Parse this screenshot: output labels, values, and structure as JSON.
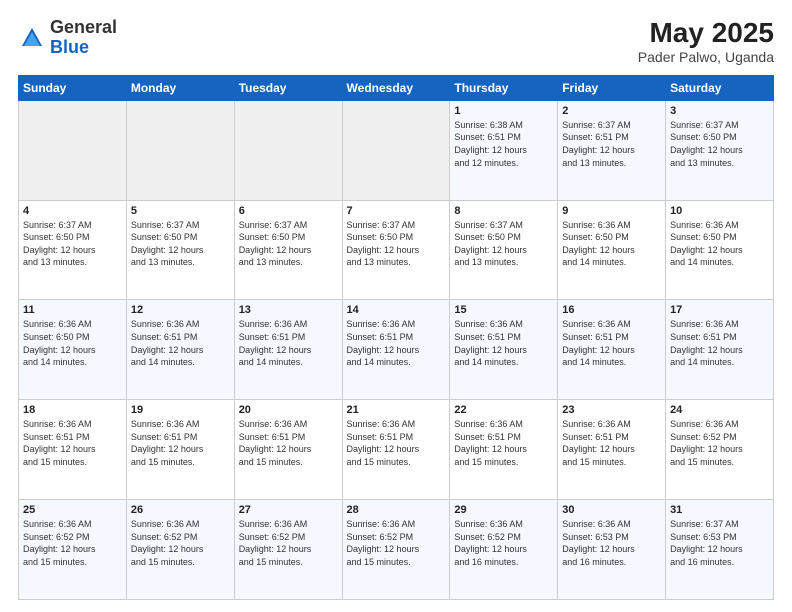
{
  "header": {
    "logo_general": "General",
    "logo_blue": "Blue",
    "month_title": "May 2025",
    "location": "Pader Palwo, Uganda"
  },
  "days_of_week": [
    "Sunday",
    "Monday",
    "Tuesday",
    "Wednesday",
    "Thursday",
    "Friday",
    "Saturday"
  ],
  "weeks": [
    [
      {
        "day": "",
        "info": ""
      },
      {
        "day": "",
        "info": ""
      },
      {
        "day": "",
        "info": ""
      },
      {
        "day": "",
        "info": ""
      },
      {
        "day": "1",
        "info": "Sunrise: 6:38 AM\nSunset: 6:51 PM\nDaylight: 12 hours\nand 12 minutes."
      },
      {
        "day": "2",
        "info": "Sunrise: 6:37 AM\nSunset: 6:51 PM\nDaylight: 12 hours\nand 13 minutes."
      },
      {
        "day": "3",
        "info": "Sunrise: 6:37 AM\nSunset: 6:50 PM\nDaylight: 12 hours\nand 13 minutes."
      }
    ],
    [
      {
        "day": "4",
        "info": "Sunrise: 6:37 AM\nSunset: 6:50 PM\nDaylight: 12 hours\nand 13 minutes."
      },
      {
        "day": "5",
        "info": "Sunrise: 6:37 AM\nSunset: 6:50 PM\nDaylight: 12 hours\nand 13 minutes."
      },
      {
        "day": "6",
        "info": "Sunrise: 6:37 AM\nSunset: 6:50 PM\nDaylight: 12 hours\nand 13 minutes."
      },
      {
        "day": "7",
        "info": "Sunrise: 6:37 AM\nSunset: 6:50 PM\nDaylight: 12 hours\nand 13 minutes."
      },
      {
        "day": "8",
        "info": "Sunrise: 6:37 AM\nSunset: 6:50 PM\nDaylight: 12 hours\nand 13 minutes."
      },
      {
        "day": "9",
        "info": "Sunrise: 6:36 AM\nSunset: 6:50 PM\nDaylight: 12 hours\nand 14 minutes."
      },
      {
        "day": "10",
        "info": "Sunrise: 6:36 AM\nSunset: 6:50 PM\nDaylight: 12 hours\nand 14 minutes."
      }
    ],
    [
      {
        "day": "11",
        "info": "Sunrise: 6:36 AM\nSunset: 6:50 PM\nDaylight: 12 hours\nand 14 minutes."
      },
      {
        "day": "12",
        "info": "Sunrise: 6:36 AM\nSunset: 6:51 PM\nDaylight: 12 hours\nand 14 minutes."
      },
      {
        "day": "13",
        "info": "Sunrise: 6:36 AM\nSunset: 6:51 PM\nDaylight: 12 hours\nand 14 minutes."
      },
      {
        "day": "14",
        "info": "Sunrise: 6:36 AM\nSunset: 6:51 PM\nDaylight: 12 hours\nand 14 minutes."
      },
      {
        "day": "15",
        "info": "Sunrise: 6:36 AM\nSunset: 6:51 PM\nDaylight: 12 hours\nand 14 minutes."
      },
      {
        "day": "16",
        "info": "Sunrise: 6:36 AM\nSunset: 6:51 PM\nDaylight: 12 hours\nand 14 minutes."
      },
      {
        "day": "17",
        "info": "Sunrise: 6:36 AM\nSunset: 6:51 PM\nDaylight: 12 hours\nand 14 minutes."
      }
    ],
    [
      {
        "day": "18",
        "info": "Sunrise: 6:36 AM\nSunset: 6:51 PM\nDaylight: 12 hours\nand 15 minutes."
      },
      {
        "day": "19",
        "info": "Sunrise: 6:36 AM\nSunset: 6:51 PM\nDaylight: 12 hours\nand 15 minutes."
      },
      {
        "day": "20",
        "info": "Sunrise: 6:36 AM\nSunset: 6:51 PM\nDaylight: 12 hours\nand 15 minutes."
      },
      {
        "day": "21",
        "info": "Sunrise: 6:36 AM\nSunset: 6:51 PM\nDaylight: 12 hours\nand 15 minutes."
      },
      {
        "day": "22",
        "info": "Sunrise: 6:36 AM\nSunset: 6:51 PM\nDaylight: 12 hours\nand 15 minutes."
      },
      {
        "day": "23",
        "info": "Sunrise: 6:36 AM\nSunset: 6:51 PM\nDaylight: 12 hours\nand 15 minutes."
      },
      {
        "day": "24",
        "info": "Sunrise: 6:36 AM\nSunset: 6:52 PM\nDaylight: 12 hours\nand 15 minutes."
      }
    ],
    [
      {
        "day": "25",
        "info": "Sunrise: 6:36 AM\nSunset: 6:52 PM\nDaylight: 12 hours\nand 15 minutes."
      },
      {
        "day": "26",
        "info": "Sunrise: 6:36 AM\nSunset: 6:52 PM\nDaylight: 12 hours\nand 15 minutes."
      },
      {
        "day": "27",
        "info": "Sunrise: 6:36 AM\nSunset: 6:52 PM\nDaylight: 12 hours\nand 15 minutes."
      },
      {
        "day": "28",
        "info": "Sunrise: 6:36 AM\nSunset: 6:52 PM\nDaylight: 12 hours\nand 15 minutes."
      },
      {
        "day": "29",
        "info": "Sunrise: 6:36 AM\nSunset: 6:52 PM\nDaylight: 12 hours\nand 16 minutes."
      },
      {
        "day": "30",
        "info": "Sunrise: 6:36 AM\nSunset: 6:53 PM\nDaylight: 12 hours\nand 16 minutes."
      },
      {
        "day": "31",
        "info": "Sunrise: 6:37 AM\nSunset: 6:53 PM\nDaylight: 12 hours\nand 16 minutes."
      }
    ]
  ]
}
